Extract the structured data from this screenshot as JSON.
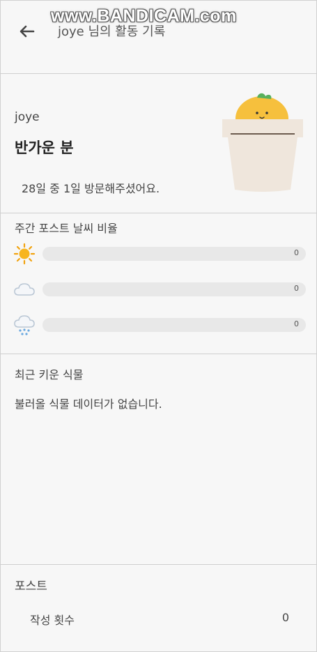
{
  "watermark": "www.BANDICAM.com",
  "header": {
    "title": "joye 님의 활동 기록",
    "back_icon": "arrow-left-icon"
  },
  "profile": {
    "username": "joye",
    "greeting": "반가운 분",
    "visit_text": "28일 중 1일 방문해주셨어요.",
    "plant_icon": "sprout-pot-icon"
  },
  "weather": {
    "title": "주간 포스트 날씨 비율",
    "rows": [
      {
        "icon": "sun-icon",
        "value": "0",
        "ratio": 0
      },
      {
        "icon": "cloud-icon",
        "value": "0",
        "ratio": 0
      },
      {
        "icon": "rain-icon",
        "value": "0",
        "ratio": 0
      }
    ]
  },
  "recent": {
    "title": "최근 키운 식물",
    "empty_text": "불러올 식물 데이터가 없습니다."
  },
  "posts": {
    "title": "포스트",
    "count_label": "작성 횟수",
    "count_value": "0"
  }
}
